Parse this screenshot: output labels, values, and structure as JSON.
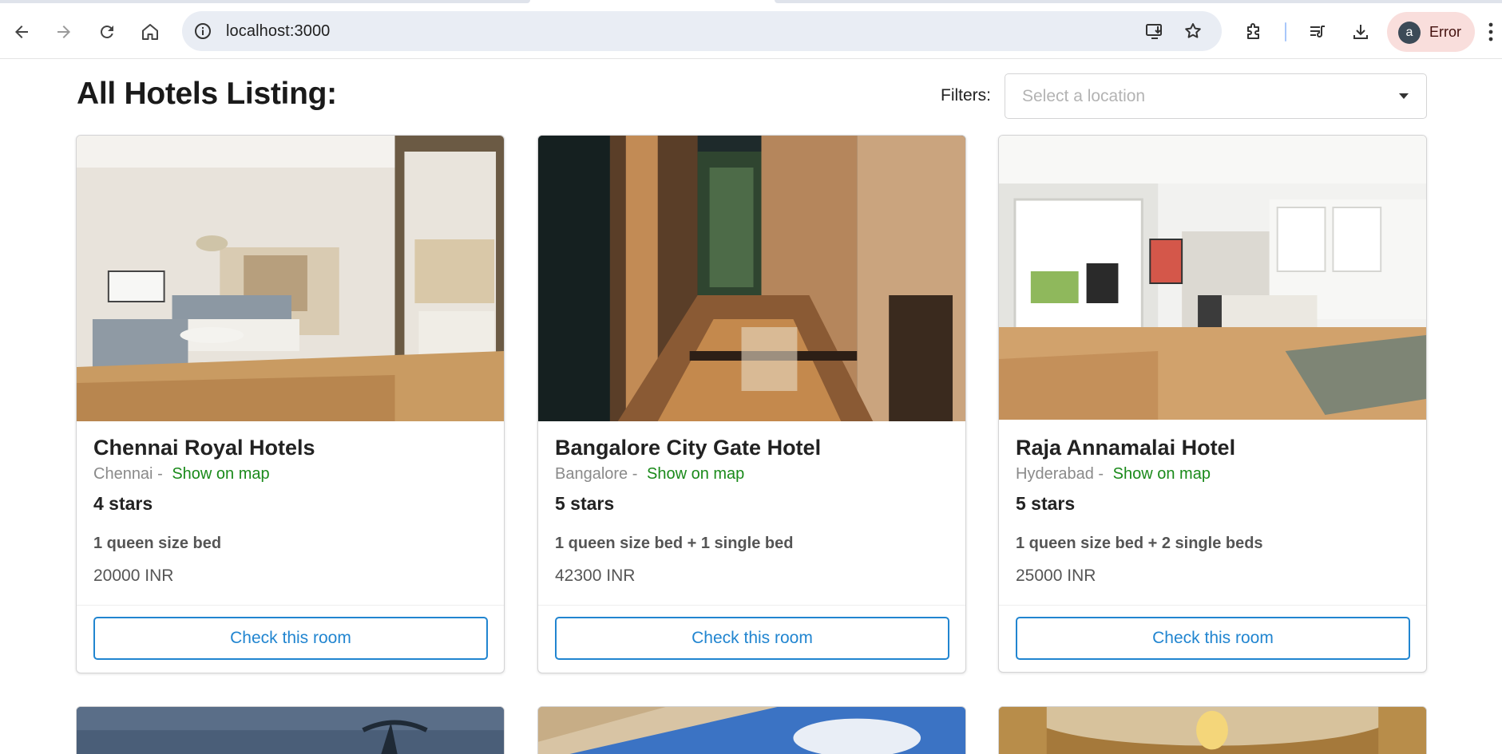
{
  "browser": {
    "url": "localhost:3000",
    "profile": {
      "initial": "a",
      "status": "Error"
    },
    "icons": [
      "back-icon",
      "forward-icon",
      "reload-icon",
      "home-icon",
      "site-info-icon",
      "install-app-icon",
      "bookmark-star-icon",
      "extensions-icon",
      "reading-list-icon",
      "downloads-icon",
      "kebab-menu-icon"
    ]
  },
  "page": {
    "title": "All Hotels Listing:",
    "filters_label": "Filters:",
    "location_select": {
      "placeholder": "Select a location",
      "value": ""
    }
  },
  "hotels": [
    {
      "name": "Chennai Royal Hotels",
      "city": "Chennai",
      "separator": "-",
      "map_link": "Show on map",
      "stars": "4 stars",
      "beds": "1 queen size bed",
      "price": "20000 INR",
      "cta": "Check this room"
    },
    {
      "name": "Bangalore City Gate Hotel",
      "city": "Bangalore",
      "separator": "-",
      "map_link": "Show on map",
      "stars": "5 stars",
      "beds": "1 queen size bed + 1 single bed",
      "price": "42300 INR",
      "cta": "Check this room"
    },
    {
      "name": "Raja Annamalai Hotel",
      "city": "Hyderabad",
      "separator": "-",
      "map_link": "Show on map",
      "stars": "5 stars",
      "beds": "1 queen size bed + 2 single beds",
      "price": "25000 INR",
      "cta": "Check this room"
    }
  ],
  "colors": {
    "link_green": "#1a8a1a",
    "button_blue": "#2185d0",
    "profile_chip": "#f9dedc",
    "omnibox": "#e9edf4"
  }
}
